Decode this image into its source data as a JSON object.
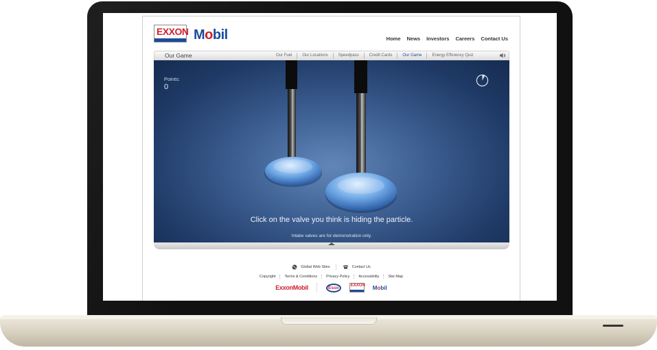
{
  "brand": {
    "exxon": "EXXON",
    "mobil_pre": "M",
    "mobil_o": "o",
    "mobil_post": "bil"
  },
  "top_links": [
    "Home",
    "News",
    "Investors",
    "Careers",
    "Contact Us"
  ],
  "nav": {
    "section_title": "Our Game",
    "tabs": [
      "Our Fuel",
      "Our Locations",
      "Speedpass",
      "Credit Cards",
      "Our Game",
      "Energy Efficiency Quiz"
    ],
    "active_tab": "Our Game"
  },
  "game": {
    "points_label": "Points:",
    "points_value": "0",
    "prompt": "Click on the valve you think is hiding the particle.",
    "disclaimer": "Intake valves are for demonstration only."
  },
  "footer": {
    "global_sites": "Global Web Sites",
    "contact_us": "Contact Us",
    "links": [
      "Copyright",
      "Terms & Conditions",
      "Privacy Policy",
      "Accessibility",
      "Site Map"
    ],
    "brands": {
      "exxonmobil": "ExxonMobil",
      "esso": "Esso",
      "exxon": "EXXON",
      "mobil_pre": "M",
      "mobil_o": "o",
      "mobil_post": "bil"
    }
  },
  "colors": {
    "exxon_red": "#d01f2e",
    "mobil_blue": "#1b4b9b",
    "game_bg": "#3c5e91",
    "active_tab": "#1b4b9b"
  },
  "icons": [
    "speaker-icon",
    "timer-icon",
    "globe-icon",
    "phone-icon",
    "collapse-arrow-icon"
  ]
}
